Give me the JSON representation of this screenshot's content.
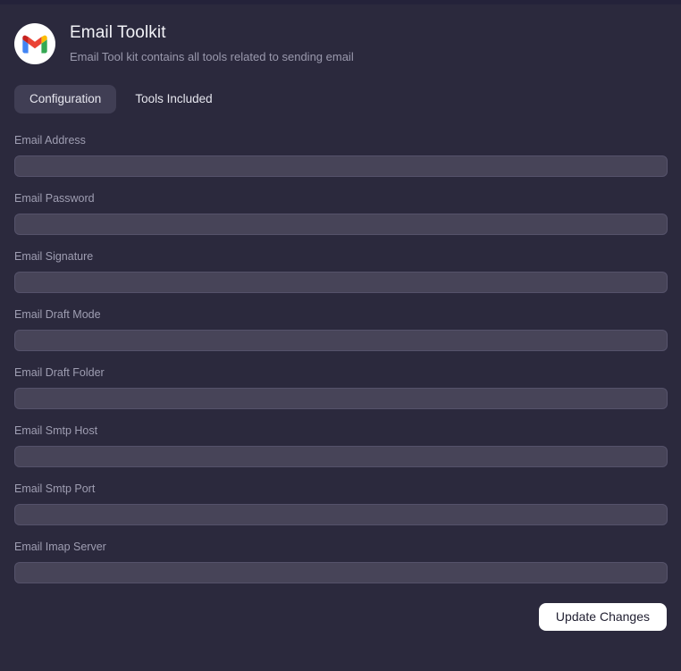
{
  "app": {
    "logo_icon": "gmail-icon",
    "title": "Email Toolkit",
    "subtitle": "Email Tool kit contains all tools related to sending email"
  },
  "tabs": [
    {
      "label": "Configuration",
      "active": true
    },
    {
      "label": "Tools Included",
      "active": false
    }
  ],
  "form": {
    "fields": [
      {
        "label": "Email Address",
        "value": "",
        "placeholder": "",
        "name": "email-address"
      },
      {
        "label": "Email Password",
        "value": "",
        "placeholder": "",
        "name": "email-password"
      },
      {
        "label": "Email Signature",
        "value": "",
        "placeholder": "",
        "name": "email-signature"
      },
      {
        "label": "Email Draft Mode",
        "value": "",
        "placeholder": "",
        "name": "email-draft-mode"
      },
      {
        "label": "Email Draft Folder",
        "value": "",
        "placeholder": "",
        "name": "email-draft-folder"
      },
      {
        "label": "Email Smtp Host",
        "value": "",
        "placeholder": "",
        "name": "email-smtp-host"
      },
      {
        "label": "Email Smtp Port",
        "value": "",
        "placeholder": "",
        "name": "email-smtp-port"
      },
      {
        "label": "Email Imap Server",
        "value": "",
        "placeholder": "",
        "name": "email-imap-server"
      }
    ],
    "submit_label": "Update Changes"
  },
  "colors": {
    "background": "#2b293d",
    "top_strip": "#24223a",
    "input_fill": "#474458",
    "input_border": "#55526a",
    "active_tab": "#403e54",
    "label_text": "#9f9eb2",
    "title_text": "#f2f2f7",
    "button_bg": "#ffffff",
    "button_text": "#201f31",
    "gmail_red": "#ea4335",
    "gmail_blue": "#4285f4",
    "gmail_green": "#34a853",
    "gmail_yellow": "#fbbc04"
  }
}
